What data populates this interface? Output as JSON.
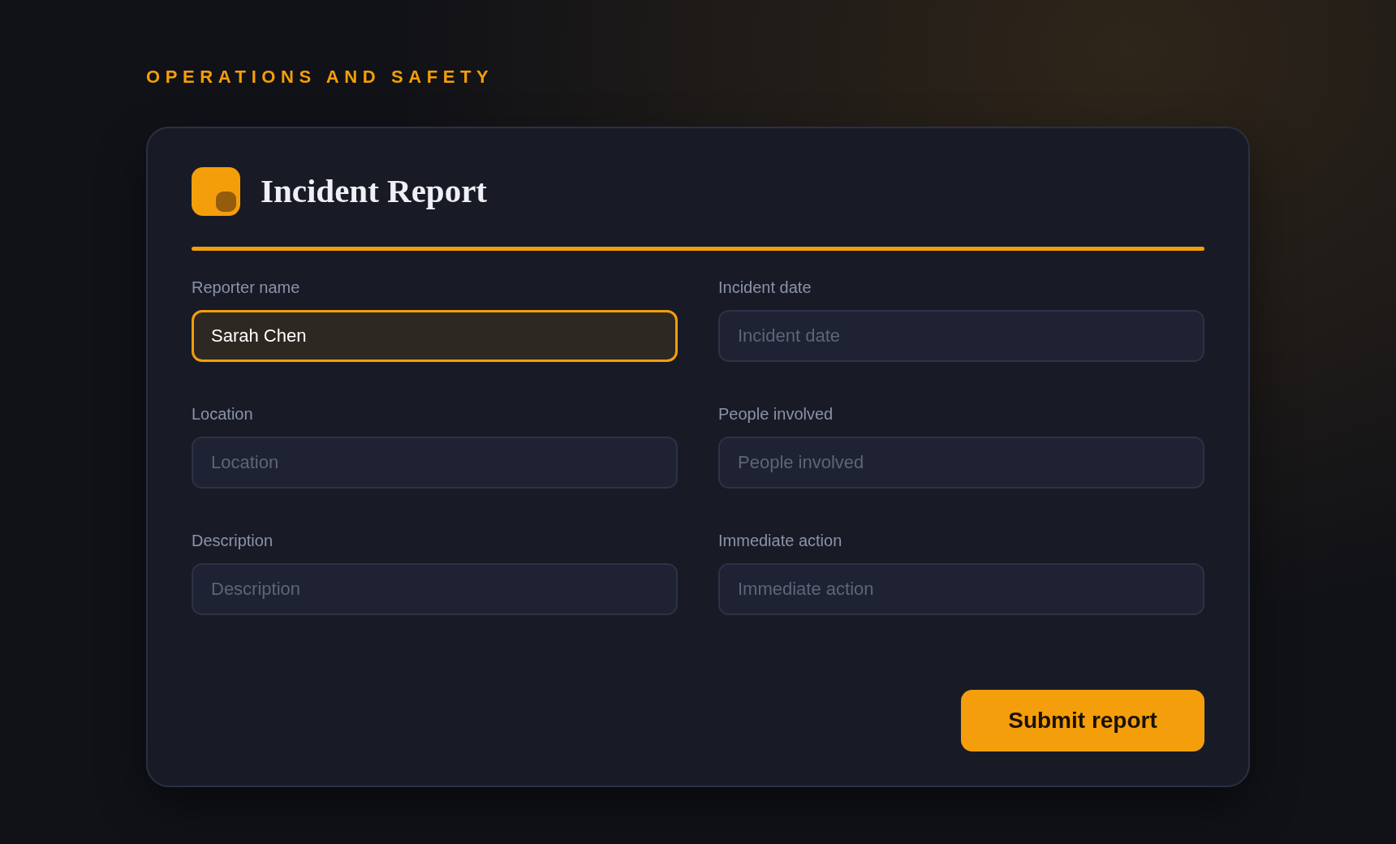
{
  "eyebrow": "OPERATIONS AND SAFETY",
  "form": {
    "title": "Incident Report",
    "fields": [
      {
        "label": "Reporter name",
        "value": "Sarah Chen",
        "focused": true
      },
      {
        "label": "Incident date",
        "placeholder": "Incident date",
        "focused": false
      },
      {
        "label": "Location",
        "placeholder": "Location",
        "focused": false
      },
      {
        "label": "People involved",
        "placeholder": "People involved",
        "focused": false
      },
      {
        "label": "Description",
        "placeholder": "Description",
        "focused": false
      },
      {
        "label": "Immediate action",
        "placeholder": "Immediate action",
        "focused": false
      }
    ],
    "submit_button": "Submit report"
  }
}
